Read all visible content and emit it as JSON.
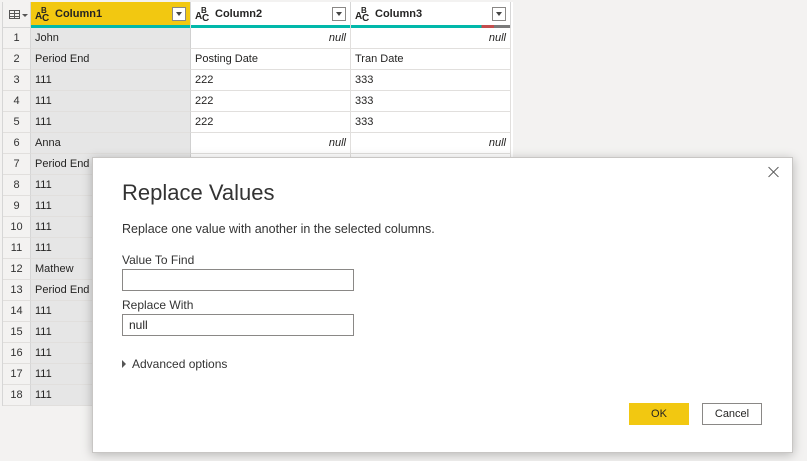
{
  "grid": {
    "columns": [
      {
        "name": "Column1",
        "type": "ABC",
        "selected": true
      },
      {
        "name": "Column2",
        "type": "ABC",
        "selected": false
      },
      {
        "name": "Column3",
        "type": "ABC",
        "selected": false
      }
    ],
    "rows": [
      {
        "n": "1",
        "c1": "John",
        "c2": "null",
        "c3": "null"
      },
      {
        "n": "2",
        "c1": "Period End",
        "c2": "Posting Date",
        "c3": "Tran Date"
      },
      {
        "n": "3",
        "c1": "111",
        "c2": "222",
        "c3": "333"
      },
      {
        "n": "4",
        "c1": "111",
        "c2": "222",
        "c3": "333"
      },
      {
        "n": "5",
        "c1": "111",
        "c2": "222",
        "c3": "333"
      },
      {
        "n": "6",
        "c1": "Anna",
        "c2": "null",
        "c3": "null"
      },
      {
        "n": "7",
        "c1": "Period End",
        "c2": "",
        "c3": ""
      },
      {
        "n": "8",
        "c1": "111",
        "c2": "",
        "c3": ""
      },
      {
        "n": "9",
        "c1": "111",
        "c2": "",
        "c3": ""
      },
      {
        "n": "10",
        "c1": "111",
        "c2": "",
        "c3": ""
      },
      {
        "n": "11",
        "c1": "111",
        "c2": "",
        "c3": ""
      },
      {
        "n": "12",
        "c1": "Mathew",
        "c2": "",
        "c3": ""
      },
      {
        "n": "13",
        "c1": "Period End",
        "c2": "",
        "c3": ""
      },
      {
        "n": "14",
        "c1": "111",
        "c2": "",
        "c3": ""
      },
      {
        "n": "15",
        "c1": "111",
        "c2": "",
        "c3": ""
      },
      {
        "n": "16",
        "c1": "111",
        "c2": "",
        "c3": ""
      },
      {
        "n": "17",
        "c1": "111",
        "c2": "",
        "c3": ""
      },
      {
        "n": "18",
        "c1": "111",
        "c2": "",
        "c3": ""
      }
    ]
  },
  "dialog": {
    "title": "Replace Values",
    "description": "Replace one value with another in the selected columns.",
    "find_label": "Value To Find",
    "find_value": "",
    "replace_label": "Replace With",
    "replace_value": "null",
    "advanced_label": "Advanced options",
    "ok_label": "OK",
    "cancel_label": "Cancel"
  },
  "colors": {
    "accent": "#f2c811",
    "quality_bar": "#01b8aa"
  },
  "icons": {
    "close": "close-icon",
    "table_menu": "table-menu-icon",
    "column_type": "text-type-icon",
    "dropdown": "dropdown-icon",
    "expand": "triangle-right-icon"
  }
}
